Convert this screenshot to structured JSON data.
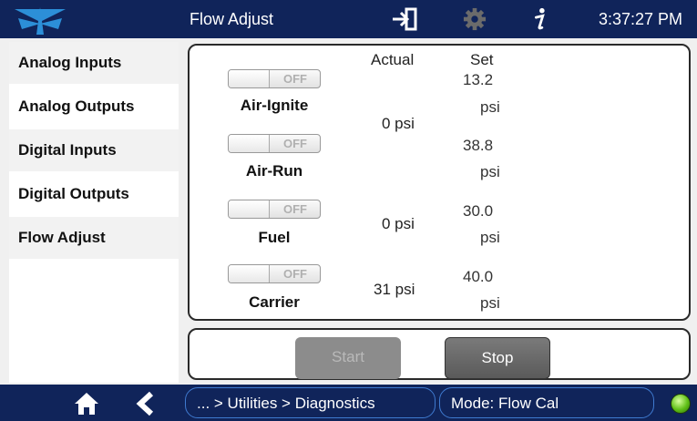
{
  "header": {
    "title": "Flow Adjust",
    "time": "3:37:27 PM",
    "icons": [
      "teledyne-logo-icon",
      "exit-icon",
      "gear-icon",
      "info-icon"
    ]
  },
  "sidebar": {
    "items": [
      {
        "label": "Analog Inputs"
      },
      {
        "label": "Analog Outputs"
      },
      {
        "label": "Digital Inputs"
      },
      {
        "label": "Digital Outputs"
      },
      {
        "label": "Flow Adjust"
      }
    ]
  },
  "flow": {
    "col_actual": "Actual",
    "col_set": "Set",
    "rows": [
      {
        "name": "Air-Ignite",
        "toggle": "OFF",
        "actual": "0 psi",
        "set": "13.2",
        "unit": "psi"
      },
      {
        "name": "Air-Run",
        "toggle": "OFF",
        "actual": "",
        "set": "38.8",
        "unit": "psi"
      },
      {
        "name": "Fuel",
        "toggle": "OFF",
        "actual": "0 psi",
        "set": "30.0",
        "unit": "psi"
      },
      {
        "name": "Carrier",
        "toggle": "OFF",
        "actual": "31 psi",
        "set": "40.0",
        "unit": "psi"
      }
    ]
  },
  "buttons": {
    "start": "Start",
    "stop": "Stop"
  },
  "footer": {
    "breadcrumb": "... > Utilities > Diagnostics",
    "mode": "Mode: Flow Cal",
    "icons": [
      "home-icon",
      "back-icon",
      "status-led-icon"
    ],
    "accent": "#10245a"
  }
}
